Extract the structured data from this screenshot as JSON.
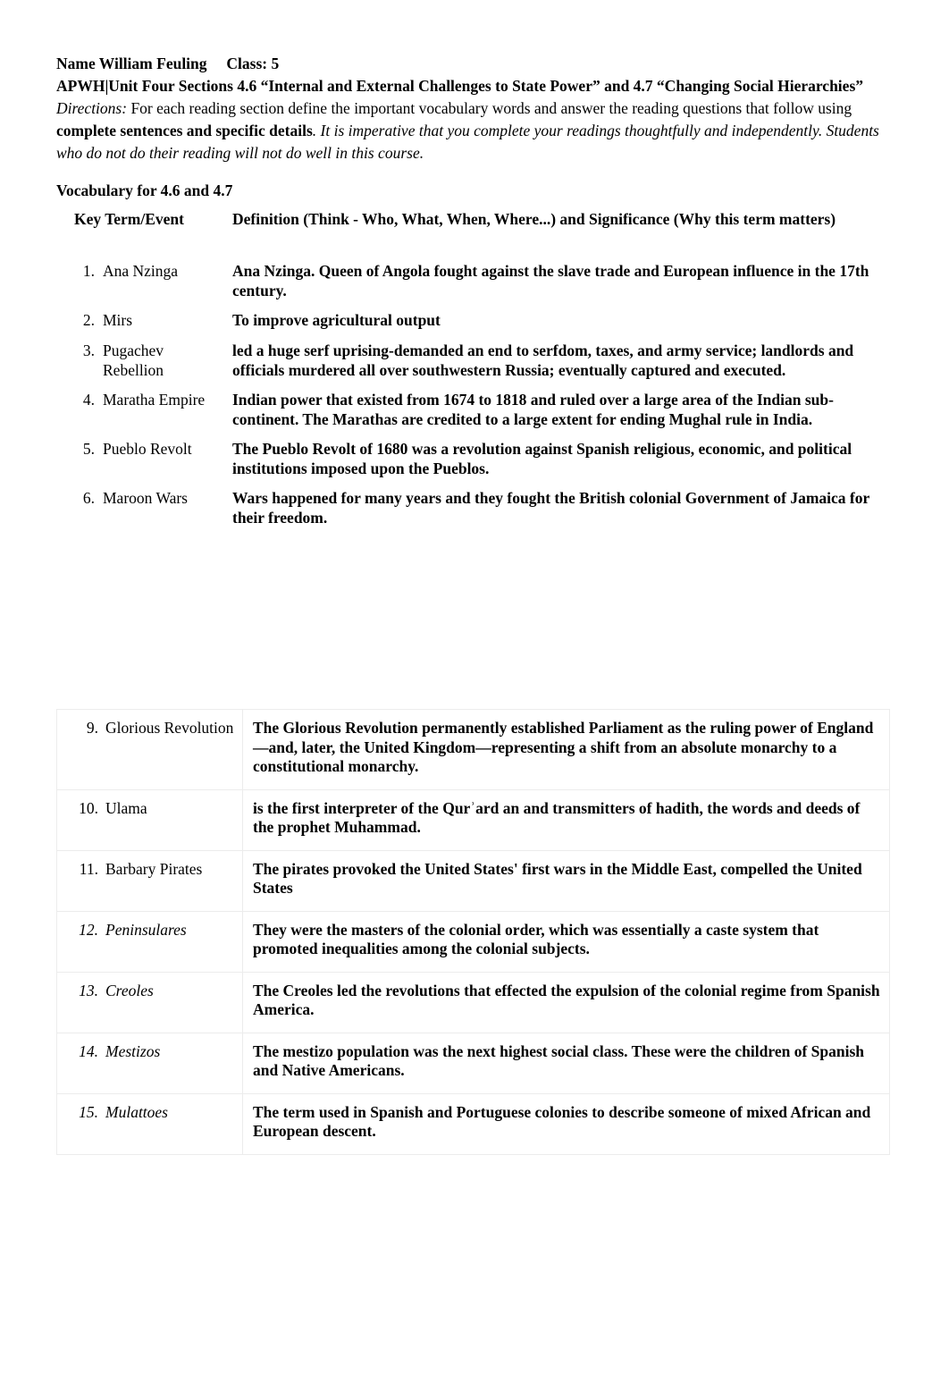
{
  "header": {
    "name_line": "Name William Feuling     Class: 5",
    "course_line": "APWH|Unit Four Sections 4.6 “Internal and External Challenges to State Power” and 4.7 “Changing Social Hierarchies”",
    "directions_label": "Directions:",
    "directions_part1": " For each reading section define the important vocabulary words and answer the reading questions that follow using ",
    "directions_bold": "complete sentences and specific details",
    "directions_part2": ". It is imperative that you complete your readings thoughtfully and independently. Students who do not do their reading will not do well in this course."
  },
  "vocabulary": {
    "section_heading": "Vocabulary for 4.6 and 4.7",
    "column_headers": {
      "term": "Key Term/Event",
      "definition": "Definition (Think - Who, What, When, Where...) and Significance (Why this term matters)"
    },
    "top_items": [
      {
        "num": "1.",
        "term": "Ana Nzinga",
        "definition": "Ana Nzinga. Queen of Angola fought against the slave trade and European influence in the 17th century."
      },
      {
        "num": "2.",
        "term": "Mirs",
        "definition": "To improve agricultural output"
      },
      {
        "num": "3.",
        "term": "Pugachev Rebellion",
        "definition": " led a huge serf uprising-demanded an end to serfdom, taxes, and army service; landlords and officials murdered all over southwestern Russia; eventually captured and executed."
      },
      {
        "num": "4.",
        "term": "Maratha Empire",
        "definition": "Indian power that existed from 1674 to 1818 and ruled over a large area of the Indian sub-continent. The Marathas are credited to a large extent for ending Mughal rule in India."
      },
      {
        "num": "5.",
        "term": "Pueblo Revolt",
        "definition": "The Pueblo Revolt of 1680 was a revolution against Spanish religious, economic, and political institutions imposed upon the Pueblos."
      },
      {
        "num": "6.",
        "term": "Maroon Wars",
        "definition": " Wars happened for many years and they fought the British colonial Government of Jamaica for their freedom."
      }
    ],
    "table_items": [
      {
        "num": "9.",
        "term": "Glorious Revolution",
        "definition": "The Glorious Revolution permanently established Parliament as the ruling power of England—and, later, the United Kingdom—representing a shift from an absolute monarchy to a constitutional monarchy.",
        "italic": false
      },
      {
        "num": "10.",
        "term": "Ulama",
        "definition": "is the first interpreter of the Qurʾard an and transmitters of hadith, the words and deeds of the prophet Muhammad.",
        "italic": false
      },
      {
        "num": "11.",
        "term": "Barbary Pirates",
        "definition": "The pirates provoked the United States' first wars in the Middle East, compelled the United States",
        "italic": false
      },
      {
        "num": "12.",
        "term": "Peninsulares",
        "definition": "They were the masters of the colonial order, which was essentially a caste system that promoted inequalities among the colonial subjects.",
        "italic": true
      },
      {
        "num": "13.",
        "term": "Creoles",
        "definition": "The Creoles led the revolutions that effected the expulsion of the colonial regime from Spanish America.",
        "italic": true
      },
      {
        "num": "14.",
        "term": "Mestizos",
        "definition": "The mestizo population was the next highest social class. These were the children of Spanish and Native Americans.",
        "italic": true
      },
      {
        "num": "15.",
        "term": "Mulattoes",
        "definition": "The term used in Spanish and Portuguese colonies to describe someone of mixed African and European descent.",
        "italic": true
      }
    ]
  },
  "footer": {
    "left_artifact": " ",
    "right_artifact": " "
  }
}
